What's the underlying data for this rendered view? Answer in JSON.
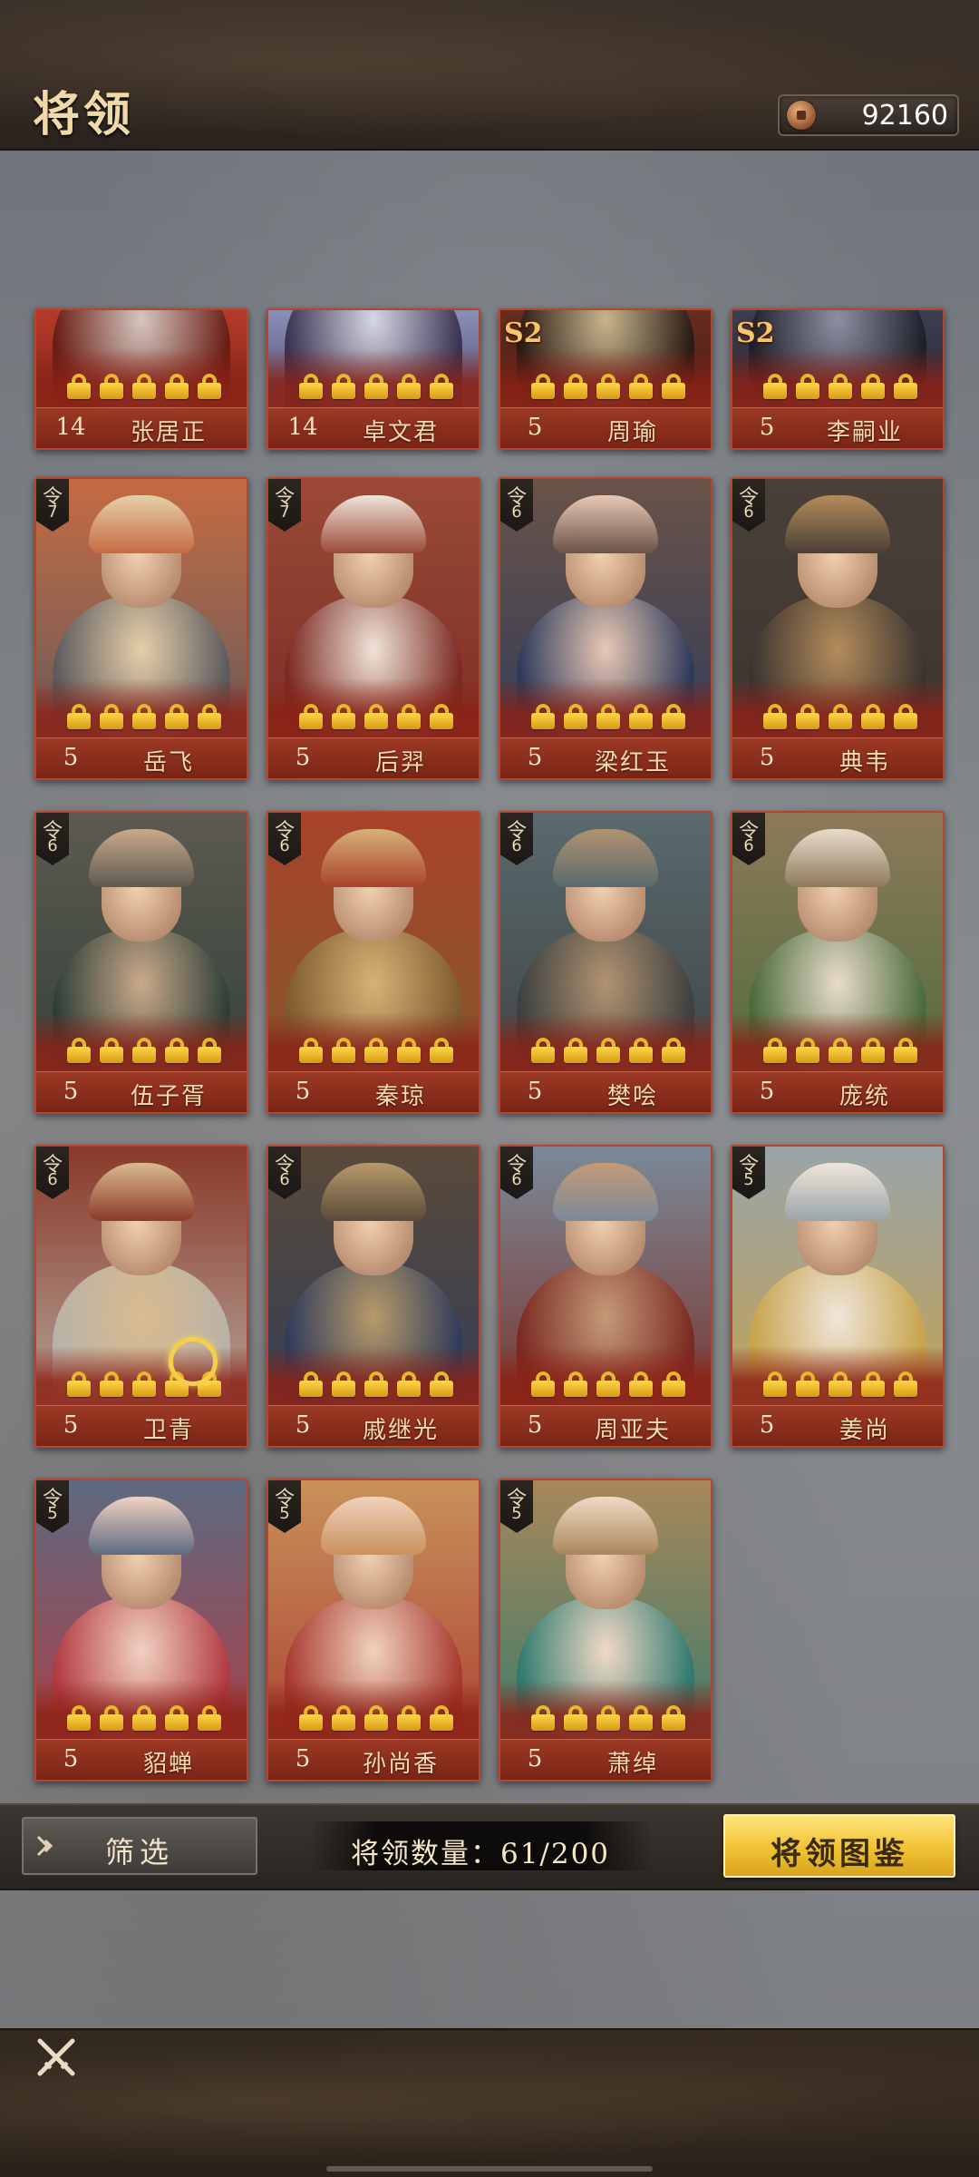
{
  "header": {
    "title": "将领",
    "coins": "92160"
  },
  "generals": [
    {
      "name": "张居正",
      "level": "14",
      "rank": "",
      "season": "",
      "partial": true,
      "palette": [
        "#b73a2a",
        "#d4c7c0",
        "#6a1d14"
      ]
    },
    {
      "name": "卓文君",
      "level": "14",
      "rank": "",
      "season": "",
      "partial": true,
      "palette": [
        "#8a8fb8",
        "#d6d7e4",
        "#3a3352"
      ]
    },
    {
      "name": "周瑜",
      "level": "5",
      "rank": "",
      "season": "S2",
      "partial": true,
      "palette": [
        "#6a2c1e",
        "#c7b58c",
        "#2a1a14"
      ]
    },
    {
      "name": "李嗣业",
      "level": "5",
      "rank": "",
      "season": "S2",
      "partial": true,
      "palette": [
        "#3a3f52",
        "#8b8fa0",
        "#1f1f2a"
      ]
    },
    {
      "name": "岳飞",
      "level": "5",
      "rank": "7",
      "season": "",
      "partial": false,
      "palette": [
        "#c56b42",
        "#e6cfa8",
        "#5c5a5e"
      ]
    },
    {
      "name": "后羿",
      "level": "5",
      "rank": "7",
      "season": "",
      "partial": false,
      "palette": [
        "#9a4a36",
        "#efe4d8",
        "#7a2a22"
      ]
    },
    {
      "name": "梁红玉",
      "level": "5",
      "rank": "6",
      "season": "",
      "partial": false,
      "palette": [
        "#6a5348",
        "#e8c8b4",
        "#2c3a5a"
      ]
    },
    {
      "name": "典韦",
      "level": "5",
      "rank": "6",
      "season": "",
      "partial": false,
      "palette": [
        "#4a4038",
        "#b48c5a",
        "#3a3430"
      ]
    },
    {
      "name": "伍子胥",
      "level": "5",
      "rank": "6",
      "season": "",
      "partial": false,
      "palette": [
        "#5d5a50",
        "#c9a989",
        "#2e3f38"
      ]
    },
    {
      "name": "秦琼",
      "level": "5",
      "rank": "6",
      "season": "",
      "partial": false,
      "palette": [
        "#a9422a",
        "#d7b176",
        "#7e5b2e"
      ]
    },
    {
      "name": "樊哙",
      "level": "5",
      "rank": "6",
      "season": "",
      "partial": false,
      "palette": [
        "#5a6a6e",
        "#b19370",
        "#3c4040"
      ]
    },
    {
      "name": "庞统",
      "level": "5",
      "rank": "6",
      "season": "",
      "partial": false,
      "palette": [
        "#8d7a5a",
        "#e9dccb",
        "#4a6a3a"
      ]
    },
    {
      "name": "卫青",
      "level": "5",
      "rank": "6",
      "season": "",
      "partial": false,
      "palette": [
        "#8a3a2a",
        "#d9bb8e",
        "#b9b2a8"
      ]
    },
    {
      "name": "戚继光",
      "level": "5",
      "rank": "6",
      "season": "",
      "partial": false,
      "palette": [
        "#5a4a3a",
        "#b79a6a",
        "#2f3c5a"
      ]
    },
    {
      "name": "周亚夫",
      "level": "5",
      "rank": "6",
      "season": "",
      "partial": false,
      "palette": [
        "#7a8a98",
        "#c49a78",
        "#7a2a22"
      ]
    },
    {
      "name": "姜尚",
      "level": "5",
      "rank": "5",
      "season": "",
      "partial": false,
      "palette": [
        "#9aa4a8",
        "#efe6da",
        "#c6a24a"
      ]
    },
    {
      "name": "貂蝉",
      "level": "5",
      "rank": "5",
      "season": "",
      "partial": false,
      "palette": [
        "#5e6a80",
        "#f1d2c2",
        "#b23a42"
      ]
    },
    {
      "name": "孙尚香",
      "level": "5",
      "rank": "5",
      "season": "",
      "partial": false,
      "palette": [
        "#c9915a",
        "#f0d2bc",
        "#a83a30"
      ]
    },
    {
      "name": "萧绰",
      "level": "5",
      "rank": "5",
      "season": "",
      "partial": false,
      "palette": [
        "#a8875a",
        "#f2d9c6",
        "#2f7a6e"
      ]
    }
  ],
  "rank_glyph": "令",
  "toolbar": {
    "filter_label": "筛选",
    "count_text": "将领数量：61/200",
    "codex_label": "将领图鉴"
  },
  "colors": {
    "card_border": "#b4452f",
    "lock_gold": "#f0c233",
    "accent_gold": "#f2c76b"
  }
}
